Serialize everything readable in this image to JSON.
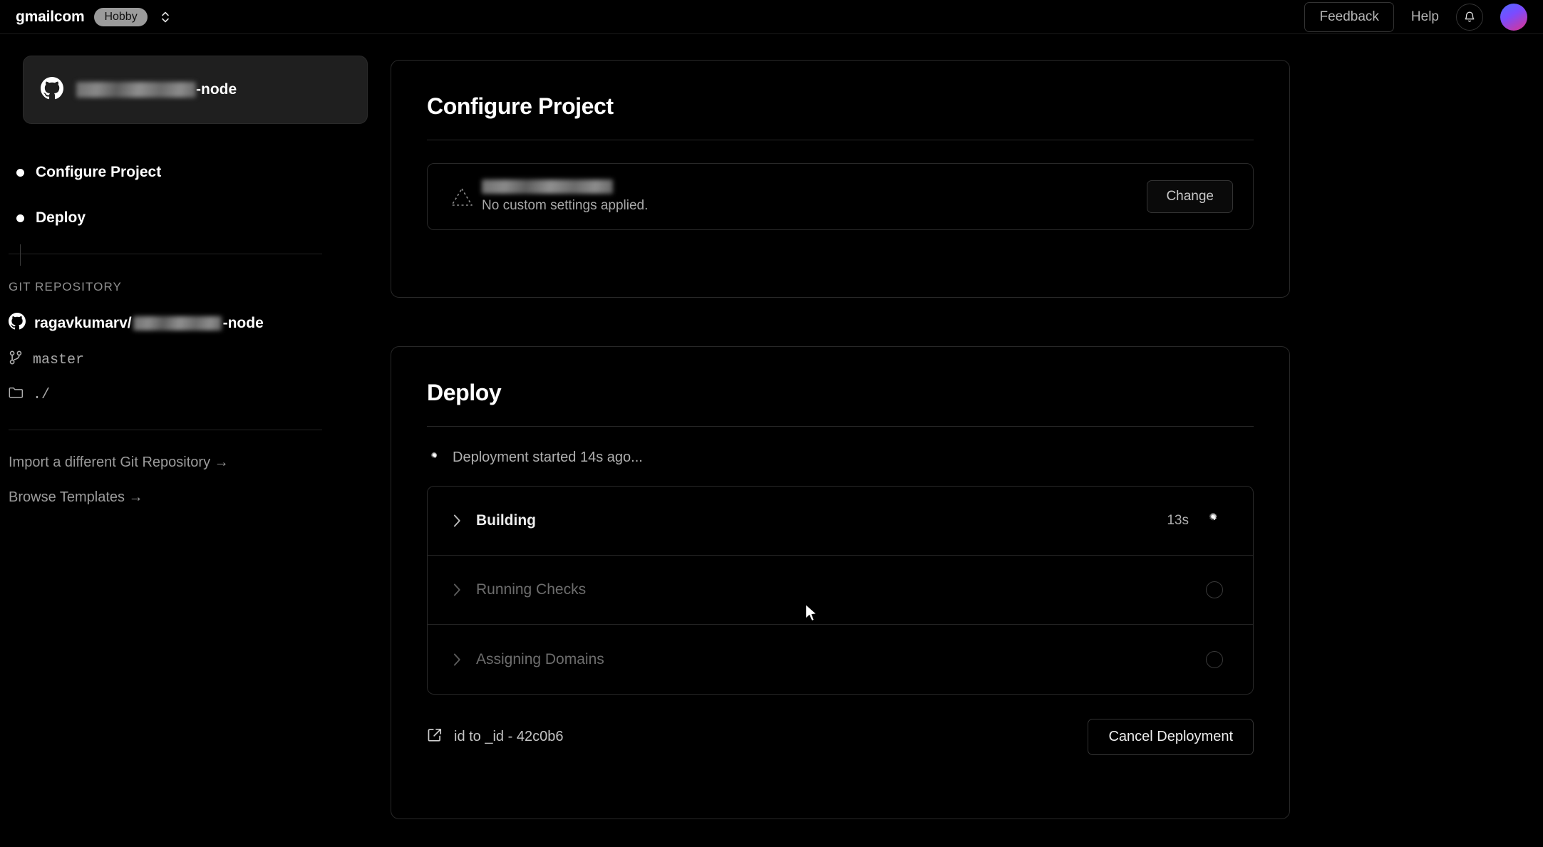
{
  "header": {
    "team_name": "gmailcom",
    "plan_badge": "Hobby",
    "scope_switch_icon": "chevron-up-down-icon",
    "feedback_label": "Feedback",
    "help_label": "Help",
    "notifications_icon": "bell-icon",
    "avatar_icon": "user-avatar",
    "avatar_gradient_from": "#4f6bff",
    "avatar_gradient_to": "#e0338b"
  },
  "sidebar": {
    "repo_card": {
      "icon": "github-icon",
      "name_redacted": "██████████",
      "name_suffix": "-node"
    },
    "steps": [
      {
        "label": "Configure Project",
        "state": "active"
      },
      {
        "label": "Deploy",
        "state": "active"
      }
    ],
    "git_section_title": "GIT REPOSITORY",
    "git_owner": "ragavkumarv/",
    "git_repo_suffix": "-node",
    "git_icon": "github-icon",
    "branch_icon": "git-branch-icon",
    "branch": "master",
    "directory_icon": "folder-icon",
    "directory": "./",
    "links": [
      {
        "label": "Import a different Git Repository →"
      },
      {
        "label": "Browse Templates →"
      }
    ]
  },
  "configure_card": {
    "title": "Configure Project",
    "framework_icon": "vercel-triangle-outline-icon",
    "framework_name_redacted": "████████████",
    "framework_subtitle": "No custom settings applied.",
    "change_label": "Change"
  },
  "deploy_card": {
    "title": "Deploy",
    "status_icon": "spinner-icon",
    "status_text": "Deployment started 14s ago...",
    "steps": [
      {
        "label": "Building",
        "duration": "13s",
        "state": "running",
        "chevron": "chevron-right-icon",
        "indicator": "spinner-icon"
      },
      {
        "label": "Running Checks",
        "duration": "",
        "state": "pending",
        "chevron": "chevron-right-icon",
        "indicator": "empty-circle-icon"
      },
      {
        "label": "Assigning Domains",
        "duration": "",
        "state": "pending",
        "chevron": "chevron-right-icon",
        "indicator": "empty-circle-icon"
      }
    ],
    "deployment_id_icon": "external-link-icon",
    "deployment_id": "id to _id - 42c0b6",
    "cancel_label": "Cancel Deployment"
  }
}
